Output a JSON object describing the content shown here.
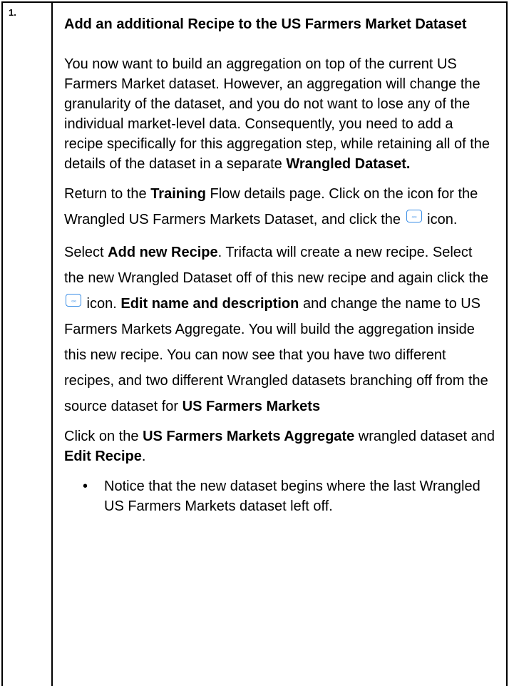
{
  "step": {
    "number": "1.",
    "title": "Add an additional Recipe to the US Farmers Market Dataset"
  },
  "para1": {
    "text": "You now want to build an aggregation on top of the current US Farmers Market dataset. However, an aggregation will change the granularity of the dataset, and you do not want to lose any of the individual market-level data. Consequently, you need to add a recipe specifically for this aggregation step, while retaining all of the details of the dataset in a separate ",
    "bold": "Wrangled Dataset."
  },
  "para2": {
    "t1": "Return to the ",
    "b1": "Training",
    "t2": " Flow details page. Click on the icon for the Wrangled US Farmers Markets Dataset, and click the ",
    "t3": " icon."
  },
  "para3": {
    "t1": "Select ",
    "b1": "Add new Recipe",
    "t2": ". Trifacta will create a new recipe. Select the new Wrangled Dataset off of this new recipe and again click the ",
    "t3": " icon. ",
    "b2": "Edit name and description",
    "t4": " and change the name to US Farmers Markets Aggregate. You will build the aggregation inside this new recipe. You can now see that you have two different recipes, and two different Wrangled datasets branching off from the source dataset for ",
    "b3": "US Farmers Markets"
  },
  "para4": {
    "t1": "Click on the ",
    "b1": "US Farmers Markets Aggregate",
    "t2": " wrangled dataset and ",
    "b2": "Edit Recipe",
    "t3": "."
  },
  "bullets": [
    "Notice that the new dataset begins where the last Wrangled US Farmers Markets dataset left off."
  ],
  "icons": {
    "more_options": "ellipsis-more-icon"
  }
}
